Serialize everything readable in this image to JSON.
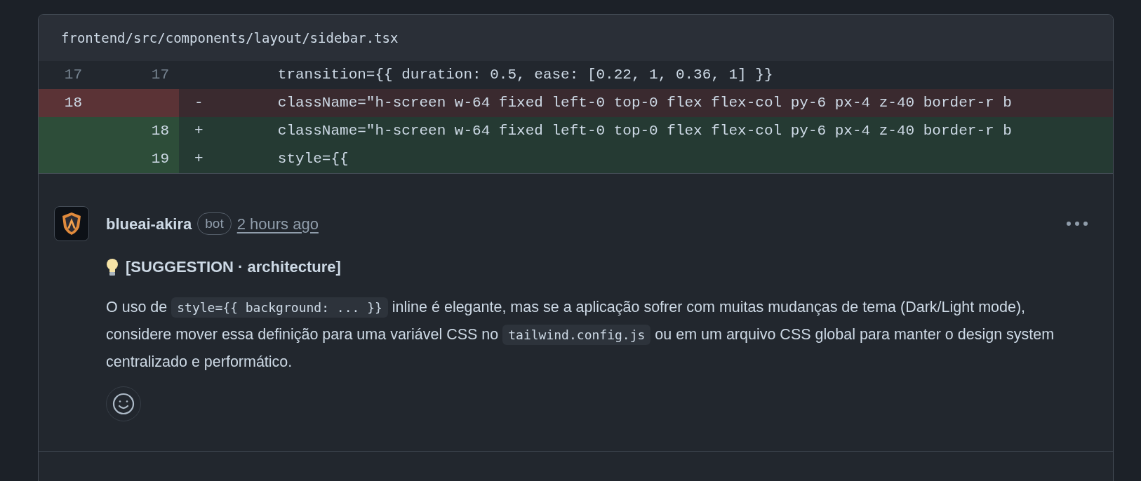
{
  "file": {
    "path": "frontend/src/components/layout/sidebar.tsx"
  },
  "diff": {
    "lines": [
      {
        "kind": "context",
        "old": "17",
        "new": "17",
        "code": "        transition={{ duration: 0.5, ease: [0.22, 1, 0.36, 1] }}"
      },
      {
        "kind": "deleted",
        "old": "18",
        "sign": "-",
        "code": "        className=\"h-screen w-64 fixed left-0 top-0 flex flex-col py-6 px-4 z-40 border-r b"
      },
      {
        "kind": "added",
        "new": "18",
        "sign": "+",
        "code": "        className=\"h-screen w-64 fixed left-0 top-0 flex flex-col py-6 px-4 z-40 border-r b"
      },
      {
        "kind": "added",
        "new": "19",
        "sign": "+",
        "code": "        style={{"
      }
    ]
  },
  "comment": {
    "author": "blueai-akira",
    "badge": "bot",
    "time": "2 hours ago",
    "title": "[SUGGESTION · architecture]",
    "body": [
      {
        "kind": "text",
        "text": "O uso de "
      },
      {
        "kind": "code",
        "text": "style={{ background: ... }}"
      },
      {
        "kind": "text",
        "text": " inline é elegante, mas se a aplicação sofrer com muitas mudanças de tema (Dark/Light mode), considere mover essa definição para uma variável CSS no "
      },
      {
        "kind": "code",
        "text": "tailwind.config.js"
      },
      {
        "kind": "text",
        "text": " ou em um arquivo CSS global para manter o design system centralizado e performático."
      }
    ]
  }
}
